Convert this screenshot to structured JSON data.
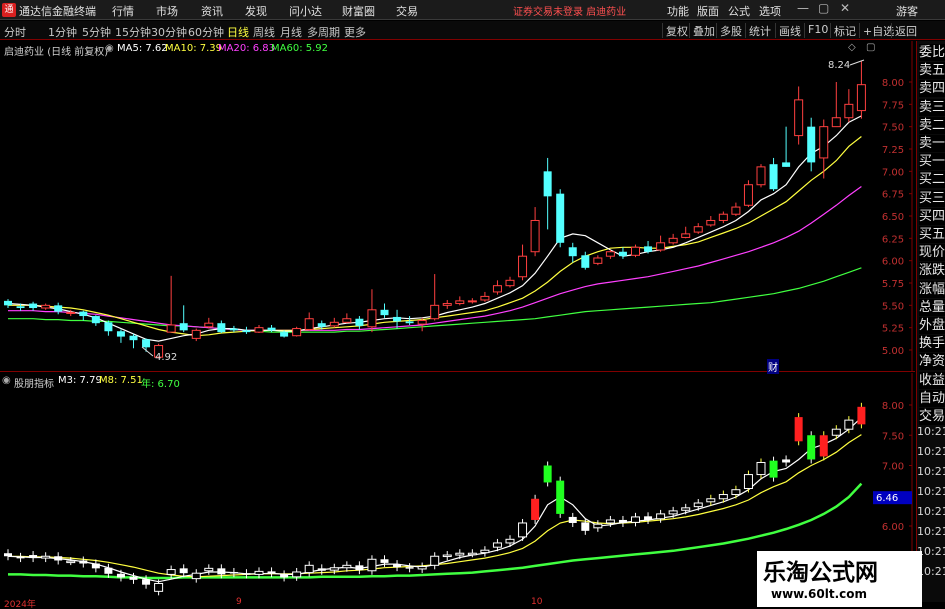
{
  "app": {
    "title": "通达信金融终端",
    "logo_text": "通",
    "notice": "证券交易未登录 启迪药业",
    "menu": [
      "行情",
      "市场",
      "资讯",
      "发现",
      "问小达",
      "财富圈",
      "交易"
    ],
    "tools": [
      "功能",
      "版面",
      "公式",
      "选项"
    ],
    "user": "游客",
    "win": [
      "—",
      "▢",
      "✕"
    ]
  },
  "periods": [
    "分时",
    "1分钟",
    "5分钟",
    "15分钟",
    "30分钟",
    "60分钟",
    "日线",
    "周线",
    "月线",
    "多周期",
    "更多"
  ],
  "active_period": "日线",
  "right_tools": [
    "复权",
    "叠加",
    "多股",
    "统计",
    "画线",
    "F10",
    "标记",
    "+自选",
    "返回"
  ],
  "stock": {
    "name": "启迪药业",
    "mode": "(日线 前复权)"
  },
  "ma": [
    {
      "label": "MA5: 7.62",
      "color": "#ffffff"
    },
    {
      "label": "MA10: 7.39",
      "color": "#ffff40"
    },
    {
      "label": "MA20: 6.83",
      "color": "#ff40ff"
    },
    {
      "label": "MA60: 5.92",
      "color": "#40ff40"
    }
  ],
  "ind": {
    "name": "股朋指标",
    "m3": "M3: 7.79",
    "m8": "M8: 7.51",
    "year": "年: 6.70"
  },
  "high_label": "8.24",
  "low_label": "4.92",
  "fin_mark": "财",
  "price_axis": [
    "8.00",
    "7.75",
    "7.50",
    "7.25",
    "7.00",
    "6.75",
    "6.50",
    "6.25",
    "6.00",
    "5.75",
    "5.50",
    "5.25",
    "5.00"
  ],
  "ind_axis": [
    "8.00",
    "7.50",
    "7.00",
    "6.46",
    "6.00"
  ],
  "ind_current": "6.46",
  "right_panel": [
    "委比",
    "卖五",
    "卖四",
    "卖三",
    "卖二",
    "卖一",
    "买一",
    "买二",
    "买三",
    "买四",
    "买五",
    "现价",
    "涨跌",
    "涨幅",
    "总量",
    "外盘",
    "换手",
    "净资",
    "收益",
    "自动",
    "交易"
  ],
  "times": [
    "10:21",
    "10:21",
    "10:21",
    "10:21",
    "10:21",
    "10:21",
    "10:21",
    "10:21"
  ],
  "xaxis": {
    "year": "2024年",
    "m9": "9",
    "m10": "10"
  },
  "watermark": {
    "title": "乐淘公式网",
    "url": "www.60lt.com"
  },
  "chart_data": {
    "type": "candlestick",
    "candles": [
      [
        5.55,
        5.5,
        5.57,
        5.47
      ],
      [
        5.49,
        5.47,
        5.52,
        5.44
      ],
      [
        5.52,
        5.47,
        5.54,
        5.44
      ],
      [
        5.47,
        5.5,
        5.52,
        5.45
      ],
      [
        5.5,
        5.43,
        5.53,
        5.4
      ],
      [
        5.42,
        5.42,
        5.45,
        5.38
      ],
      [
        5.43,
        5.38,
        5.44,
        5.33
      ],
      [
        5.38,
        5.3,
        5.39,
        5.27
      ],
      [
        5.31,
        5.21,
        5.33,
        5.16
      ],
      [
        5.21,
        5.15,
        5.23,
        5.08
      ],
      [
        5.16,
        5.11,
        5.18,
        5.02
      ],
      [
        5.12,
        5.03,
        5.13,
        4.98
      ],
      [
        4.92,
        5.05,
        5.07,
        4.92
      ],
      [
        5.2,
        5.28,
        5.83,
        5.22
      ],
      [
        5.3,
        5.22,
        5.5,
        5.2
      ],
      [
        5.13,
        5.22,
        5.24,
        5.1
      ],
      [
        5.26,
        5.3,
        5.36,
        5.24
      ],
      [
        5.3,
        5.2,
        5.33,
        5.19
      ],
      [
        5.24,
        5.22,
        5.27,
        5.2
      ],
      [
        5.22,
        5.2,
        5.26,
        5.18
      ],
      [
        5.2,
        5.25,
        5.28,
        5.19
      ],
      [
        5.25,
        5.22,
        5.28,
        5.2
      ],
      [
        5.2,
        5.15,
        5.22,
        5.14
      ],
      [
        5.16,
        5.24,
        5.26,
        5.15
      ],
      [
        5.23,
        5.35,
        5.42,
        5.22
      ],
      [
        5.3,
        5.26,
        5.33,
        5.23
      ],
      [
        5.27,
        5.31,
        5.36,
        5.25
      ],
      [
        5.31,
        5.35,
        5.41,
        5.3
      ],
      [
        5.35,
        5.27,
        5.38,
        5.23
      ],
      [
        5.26,
        5.45,
        5.68,
        5.2
      ],
      [
        5.45,
        5.39,
        5.52,
        5.36
      ],
      [
        5.37,
        5.32,
        5.45,
        5.24
      ],
      [
        5.32,
        5.3,
        5.38,
        5.28
      ],
      [
        5.29,
        5.33,
        5.36,
        5.21
      ],
      [
        5.35,
        5.5,
        5.85,
        5.33
      ],
      [
        5.5,
        5.52,
        5.56,
        5.46
      ],
      [
        5.52,
        5.55,
        5.6,
        5.5
      ],
      [
        5.55,
        5.55,
        5.58,
        5.52
      ],
      [
        5.56,
        5.6,
        5.65,
        5.54
      ],
      [
        5.65,
        5.72,
        5.78,
        5.62
      ],
      [
        5.72,
        5.78,
        5.82,
        5.7
      ],
      [
        5.82,
        6.05,
        6.18,
        5.78
      ],
      [
        6.1,
        6.45,
        6.6,
        6.05
      ],
      [
        7.0,
        6.72,
        7.15,
        6.35
      ],
      [
        6.75,
        6.2,
        6.8,
        6.15
      ],
      [
        6.15,
        6.05,
        6.2,
        5.98
      ],
      [
        6.06,
        5.92,
        6.1,
        5.9
      ],
      [
        5.97,
        6.03,
        6.06,
        5.95
      ],
      [
        6.05,
        6.1,
        6.12,
        6.02
      ],
      [
        6.1,
        6.05,
        6.15,
        6.02
      ],
      [
        6.06,
        6.15,
        6.18,
        6.04
      ],
      [
        6.16,
        6.1,
        6.22,
        6.08
      ],
      [
        6.12,
        6.2,
        6.28,
        6.1
      ],
      [
        6.2,
        6.25,
        6.3,
        6.18
      ],
      [
        6.26,
        6.3,
        6.38,
        6.25
      ],
      [
        6.32,
        6.38,
        6.42,
        6.3
      ],
      [
        6.4,
        6.45,
        6.5,
        6.38
      ],
      [
        6.45,
        6.52,
        6.55,
        6.42
      ],
      [
        6.52,
        6.6,
        6.65,
        6.5
      ],
      [
        6.62,
        6.85,
        6.9,
        6.6
      ],
      [
        6.85,
        7.05,
        7.08,
        6.82
      ],
      [
        7.08,
        6.8,
        7.15,
        6.78
      ],
      [
        7.1,
        7.05,
        7.5,
        7.05
      ],
      [
        7.4,
        7.8,
        7.95,
        7.3
      ],
      [
        7.5,
        7.1,
        7.6,
        7.0
      ],
      [
        7.15,
        7.5,
        7.58,
        6.92
      ],
      [
        7.5,
        7.6,
        8.0,
        7.5
      ],
      [
        7.6,
        7.75,
        7.92,
        7.55
      ],
      [
        7.68,
        7.97,
        8.24,
        7.59
      ]
    ],
    "ma5": [
      5.52,
      5.51,
      5.5,
      5.48,
      5.46,
      5.43,
      5.4,
      5.36,
      5.3,
      5.24,
      5.18,
      5.12,
      5.1,
      5.13,
      5.16,
      5.18,
      5.22,
      5.24,
      5.24,
      5.22,
      5.22,
      5.22,
      5.21,
      5.21,
      5.24,
      5.26,
      5.28,
      5.3,
      5.31,
      5.33,
      5.35,
      5.36,
      5.35,
      5.36,
      5.38,
      5.42,
      5.45,
      5.48,
      5.52,
      5.58,
      5.64,
      5.72,
      5.86,
      6.05,
      6.25,
      6.3,
      6.28,
      6.2,
      6.12,
      6.05,
      6.07,
      6.1,
      6.12,
      6.15,
      6.2,
      6.26,
      6.32,
      6.38,
      6.45,
      6.55,
      6.68,
      6.75,
      6.85,
      7.05,
      7.2,
      7.28,
      7.4,
      7.55,
      7.62
    ],
    "ma10": [
      5.5,
      5.5,
      5.5,
      5.49,
      5.48,
      5.47,
      5.45,
      5.42,
      5.39,
      5.35,
      5.31,
      5.27,
      5.23,
      5.2,
      5.18,
      5.16,
      5.17,
      5.19,
      5.2,
      5.21,
      5.22,
      5.22,
      5.22,
      5.22,
      5.23,
      5.24,
      5.25,
      5.26,
      5.27,
      5.29,
      5.31,
      5.32,
      5.33,
      5.34,
      5.36,
      5.38,
      5.4,
      5.42,
      5.44,
      5.48,
      5.53,
      5.58,
      5.66,
      5.76,
      5.88,
      5.98,
      6.05,
      6.1,
      6.14,
      6.15,
      6.15,
      6.14,
      6.14,
      6.16,
      6.18,
      6.21,
      6.26,
      6.31,
      6.36,
      6.42,
      6.5,
      6.58,
      6.66,
      6.78,
      6.9,
      7.0,
      7.12,
      7.28,
      7.39
    ],
    "ma20": [
      5.44,
      5.44,
      5.44,
      5.43,
      5.43,
      5.42,
      5.41,
      5.4,
      5.38,
      5.36,
      5.34,
      5.32,
      5.3,
      5.28,
      5.27,
      5.26,
      5.25,
      5.24,
      5.23,
      5.22,
      5.22,
      5.22,
      5.22,
      5.22,
      5.22,
      5.22,
      5.22,
      5.23,
      5.23,
      5.24,
      5.25,
      5.26,
      5.27,
      5.28,
      5.3,
      5.32,
      5.34,
      5.36,
      5.38,
      5.41,
      5.44,
      5.48,
      5.53,
      5.58,
      5.63,
      5.67,
      5.71,
      5.74,
      5.76,
      5.78,
      5.8,
      5.82,
      5.85,
      5.88,
      5.91,
      5.94,
      5.98,
      6.02,
      6.06,
      6.1,
      6.15,
      6.2,
      6.26,
      6.33,
      6.42,
      6.52,
      6.62,
      6.73,
      6.83
    ],
    "ma60": [
      5.35,
      5.35,
      5.35,
      5.34,
      5.34,
      5.33,
      5.33,
      5.32,
      5.32,
      5.31,
      5.3,
      5.29,
      5.28,
      5.27,
      5.27,
      5.26,
      5.25,
      5.24,
      5.23,
      5.22,
      5.21,
      5.2,
      5.2,
      5.2,
      5.2,
      5.2,
      5.2,
      5.21,
      5.21,
      5.22,
      5.23,
      5.24,
      5.25,
      5.26,
      5.27,
      5.28,
      5.29,
      5.3,
      5.31,
      5.32,
      5.33,
      5.34,
      5.35,
      5.37,
      5.39,
      5.41,
      5.43,
      5.44,
      5.45,
      5.46,
      5.47,
      5.48,
      5.49,
      5.5,
      5.51,
      5.52,
      5.53,
      5.55,
      5.57,
      5.59,
      5.61,
      5.63,
      5.66,
      5.69,
      5.73,
      5.77,
      5.82,
      5.87,
      5.92
    ],
    "ind_candles": [
      [
        5.55,
        5.5
      ],
      [
        5.49,
        5.47
      ],
      [
        5.52,
        5.47
      ],
      [
        5.47,
        5.5
      ],
      [
        5.5,
        5.43
      ],
      [
        5.42,
        5.42
      ],
      [
        5.43,
        5.38
      ],
      [
        5.38,
        5.3
      ],
      [
        5.31,
        5.21
      ],
      [
        5.21,
        5.15
      ],
      [
        5.16,
        5.11
      ],
      [
        5.12,
        5.03
      ],
      [
        4.92,
        5.05
      ],
      [
        5.2,
        5.28
      ],
      [
        5.3,
        5.22
      ],
      [
        5.13,
        5.22
      ],
      [
        5.26,
        5.3
      ],
      [
        5.3,
        5.2
      ],
      [
        5.24,
        5.22
      ],
      [
        5.22,
        5.2
      ],
      [
        5.2,
        5.25
      ],
      [
        5.25,
        5.22
      ],
      [
        5.2,
        5.15
      ],
      [
        5.16,
        5.24
      ],
      [
        5.23,
        5.35
      ],
      [
        5.3,
        5.26
      ],
      [
        5.27,
        5.31
      ],
      [
        5.31,
        5.35
      ],
      [
        5.35,
        5.27
      ],
      [
        5.26,
        5.45
      ],
      [
        5.45,
        5.39
      ],
      [
        5.37,
        5.32
      ],
      [
        5.32,
        5.3
      ],
      [
        5.29,
        5.33
      ],
      [
        5.35,
        5.5
      ],
      [
        5.5,
        5.52
      ],
      [
        5.52,
        5.55
      ],
      [
        5.55,
        5.55
      ],
      [
        5.56,
        5.6
      ],
      [
        5.65,
        5.72
      ],
      [
        5.72,
        5.78
      ],
      [
        5.82,
        6.05
      ],
      [
        6.1,
        6.45
      ],
      [
        7.0,
        6.72
      ],
      [
        6.75,
        6.2
      ],
      [
        6.15,
        6.05
      ],
      [
        6.06,
        5.92
      ],
      [
        5.97,
        6.03
      ],
      [
        6.05,
        6.1
      ],
      [
        6.1,
        6.05
      ],
      [
        6.06,
        6.15
      ],
      [
        6.16,
        6.1
      ],
      [
        6.12,
        6.2
      ],
      [
        6.2,
        6.25
      ],
      [
        6.26,
        6.3
      ],
      [
        6.32,
        6.38
      ],
      [
        6.4,
        6.45
      ],
      [
        6.45,
        6.52
      ],
      [
        6.52,
        6.6
      ],
      [
        6.62,
        6.85
      ],
      [
        6.85,
        7.05
      ],
      [
        7.08,
        6.8
      ],
      [
        7.1,
        7.05
      ],
      [
        7.4,
        7.8
      ],
      [
        7.5,
        7.1
      ],
      [
        7.15,
        7.5
      ],
      [
        7.5,
        7.6
      ],
      [
        7.6,
        7.75
      ],
      [
        7.68,
        7.97
      ]
    ],
    "m3": [
      5.5,
      5.49,
      5.48,
      5.48,
      5.46,
      5.44,
      5.41,
      5.37,
      5.31,
      5.24,
      5.18,
      5.12,
      5.08,
      5.12,
      5.17,
      5.2,
      5.24,
      5.24,
      5.23,
      5.21,
      5.21,
      5.22,
      5.2,
      5.2,
      5.24,
      5.28,
      5.3,
      5.32,
      5.3,
      5.33,
      5.37,
      5.37,
      5.34,
      5.32,
      5.36,
      5.42,
      5.48,
      5.52,
      5.55,
      5.6,
      5.67,
      5.78,
      6.0,
      6.35,
      6.48,
      6.35,
      6.12,
      6.0,
      6.02,
      6.06,
      6.08,
      6.1,
      6.13,
      6.16,
      6.22,
      6.28,
      6.34,
      6.4,
      6.48,
      6.6,
      6.78,
      6.9,
      6.95,
      7.1,
      7.28,
      7.35,
      7.45,
      7.6,
      7.79
    ],
    "m8": [
      5.5,
      5.5,
      5.49,
      5.49,
      5.48,
      5.47,
      5.45,
      5.43,
      5.4,
      5.36,
      5.32,
      5.27,
      5.22,
      5.19,
      5.17,
      5.16,
      5.17,
      5.18,
      5.19,
      5.2,
      5.21,
      5.21,
      5.21,
      5.21,
      5.22,
      5.23,
      5.24,
      5.26,
      5.27,
      5.29,
      5.31,
      5.32,
      5.33,
      5.34,
      5.36,
      5.38,
      5.41,
      5.44,
      5.47,
      5.51,
      5.56,
      5.63,
      5.75,
      5.92,
      6.05,
      6.1,
      6.08,
      6.05,
      6.04,
      6.05,
      6.06,
      6.08,
      6.1,
      6.12,
      6.15,
      6.19,
      6.24,
      6.29,
      6.35,
      6.43,
      6.55,
      6.65,
      6.73,
      6.88,
      7.0,
      7.1,
      7.22,
      7.38,
      7.51
    ],
    "year_line": [
      5.2,
      5.2,
      5.19,
      5.19,
      5.18,
      5.18,
      5.17,
      5.17,
      5.16,
      5.15,
      5.15,
      5.14,
      5.14,
      5.14,
      5.15,
      5.15,
      5.15,
      5.15,
      5.15,
      5.15,
      5.15,
      5.15,
      5.15,
      5.15,
      5.15,
      5.16,
      5.16,
      5.16,
      5.16,
      5.17,
      5.17,
      5.18,
      5.18,
      5.19,
      5.2,
      5.21,
      5.22,
      5.23,
      5.25,
      5.27,
      5.29,
      5.31,
      5.34,
      5.37,
      5.4,
      5.43,
      5.45,
      5.47,
      5.49,
      5.51,
      5.53,
      5.55,
      5.57,
      5.59,
      5.62,
      5.65,
      5.68,
      5.71,
      5.75,
      5.79,
      5.84,
      5.89,
      5.95,
      6.02,
      6.1,
      6.2,
      6.32,
      6.48,
      6.7
    ]
  }
}
